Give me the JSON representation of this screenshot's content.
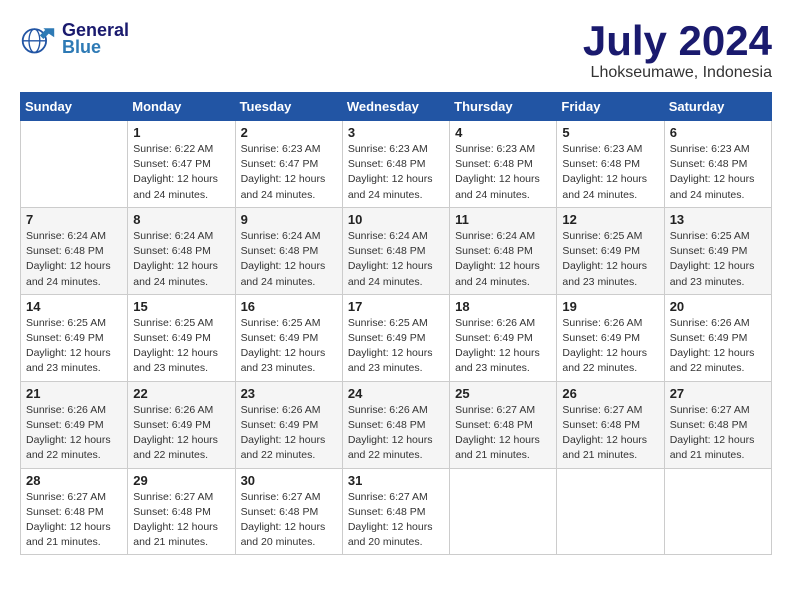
{
  "header": {
    "logo_line1": "General",
    "logo_line2": "Blue",
    "month": "July 2024",
    "location": "Lhokseumawe, Indonesia"
  },
  "columns": [
    "Sunday",
    "Monday",
    "Tuesday",
    "Wednesday",
    "Thursday",
    "Friday",
    "Saturday"
  ],
  "weeks": [
    [
      {
        "day": "",
        "info": ""
      },
      {
        "day": "1",
        "info": "Sunrise: 6:22 AM\nSunset: 6:47 PM\nDaylight: 12 hours\nand 24 minutes."
      },
      {
        "day": "2",
        "info": "Sunrise: 6:23 AM\nSunset: 6:47 PM\nDaylight: 12 hours\nand 24 minutes."
      },
      {
        "day": "3",
        "info": "Sunrise: 6:23 AM\nSunset: 6:48 PM\nDaylight: 12 hours\nand 24 minutes."
      },
      {
        "day": "4",
        "info": "Sunrise: 6:23 AM\nSunset: 6:48 PM\nDaylight: 12 hours\nand 24 minutes."
      },
      {
        "day": "5",
        "info": "Sunrise: 6:23 AM\nSunset: 6:48 PM\nDaylight: 12 hours\nand 24 minutes."
      },
      {
        "day": "6",
        "info": "Sunrise: 6:23 AM\nSunset: 6:48 PM\nDaylight: 12 hours\nand 24 minutes."
      }
    ],
    [
      {
        "day": "7",
        "info": "Sunrise: 6:24 AM\nSunset: 6:48 PM\nDaylight: 12 hours\nand 24 minutes."
      },
      {
        "day": "8",
        "info": "Sunrise: 6:24 AM\nSunset: 6:48 PM\nDaylight: 12 hours\nand 24 minutes."
      },
      {
        "day": "9",
        "info": "Sunrise: 6:24 AM\nSunset: 6:48 PM\nDaylight: 12 hours\nand 24 minutes."
      },
      {
        "day": "10",
        "info": "Sunrise: 6:24 AM\nSunset: 6:48 PM\nDaylight: 12 hours\nand 24 minutes."
      },
      {
        "day": "11",
        "info": "Sunrise: 6:24 AM\nSunset: 6:48 PM\nDaylight: 12 hours\nand 24 minutes."
      },
      {
        "day": "12",
        "info": "Sunrise: 6:25 AM\nSunset: 6:49 PM\nDaylight: 12 hours\nand 23 minutes."
      },
      {
        "day": "13",
        "info": "Sunrise: 6:25 AM\nSunset: 6:49 PM\nDaylight: 12 hours\nand 23 minutes."
      }
    ],
    [
      {
        "day": "14",
        "info": "Sunrise: 6:25 AM\nSunset: 6:49 PM\nDaylight: 12 hours\nand 23 minutes."
      },
      {
        "day": "15",
        "info": "Sunrise: 6:25 AM\nSunset: 6:49 PM\nDaylight: 12 hours\nand 23 minutes."
      },
      {
        "day": "16",
        "info": "Sunrise: 6:25 AM\nSunset: 6:49 PM\nDaylight: 12 hours\nand 23 minutes."
      },
      {
        "day": "17",
        "info": "Sunrise: 6:25 AM\nSunset: 6:49 PM\nDaylight: 12 hours\nand 23 minutes."
      },
      {
        "day": "18",
        "info": "Sunrise: 6:26 AM\nSunset: 6:49 PM\nDaylight: 12 hours\nand 23 minutes."
      },
      {
        "day": "19",
        "info": "Sunrise: 6:26 AM\nSunset: 6:49 PM\nDaylight: 12 hours\nand 22 minutes."
      },
      {
        "day": "20",
        "info": "Sunrise: 6:26 AM\nSunset: 6:49 PM\nDaylight: 12 hours\nand 22 minutes."
      }
    ],
    [
      {
        "day": "21",
        "info": "Sunrise: 6:26 AM\nSunset: 6:49 PM\nDaylight: 12 hours\nand 22 minutes."
      },
      {
        "day": "22",
        "info": "Sunrise: 6:26 AM\nSunset: 6:49 PM\nDaylight: 12 hours\nand 22 minutes."
      },
      {
        "day": "23",
        "info": "Sunrise: 6:26 AM\nSunset: 6:49 PM\nDaylight: 12 hours\nand 22 minutes."
      },
      {
        "day": "24",
        "info": "Sunrise: 6:26 AM\nSunset: 6:48 PM\nDaylight: 12 hours\nand 22 minutes."
      },
      {
        "day": "25",
        "info": "Sunrise: 6:27 AM\nSunset: 6:48 PM\nDaylight: 12 hours\nand 21 minutes."
      },
      {
        "day": "26",
        "info": "Sunrise: 6:27 AM\nSunset: 6:48 PM\nDaylight: 12 hours\nand 21 minutes."
      },
      {
        "day": "27",
        "info": "Sunrise: 6:27 AM\nSunset: 6:48 PM\nDaylight: 12 hours\nand 21 minutes."
      }
    ],
    [
      {
        "day": "28",
        "info": "Sunrise: 6:27 AM\nSunset: 6:48 PM\nDaylight: 12 hours\nand 21 minutes."
      },
      {
        "day": "29",
        "info": "Sunrise: 6:27 AM\nSunset: 6:48 PM\nDaylight: 12 hours\nand 21 minutes."
      },
      {
        "day": "30",
        "info": "Sunrise: 6:27 AM\nSunset: 6:48 PM\nDaylight: 12 hours\nand 20 minutes."
      },
      {
        "day": "31",
        "info": "Sunrise: 6:27 AM\nSunset: 6:48 PM\nDaylight: 12 hours\nand 20 minutes."
      },
      {
        "day": "",
        "info": ""
      },
      {
        "day": "",
        "info": ""
      },
      {
        "day": "",
        "info": ""
      }
    ]
  ]
}
